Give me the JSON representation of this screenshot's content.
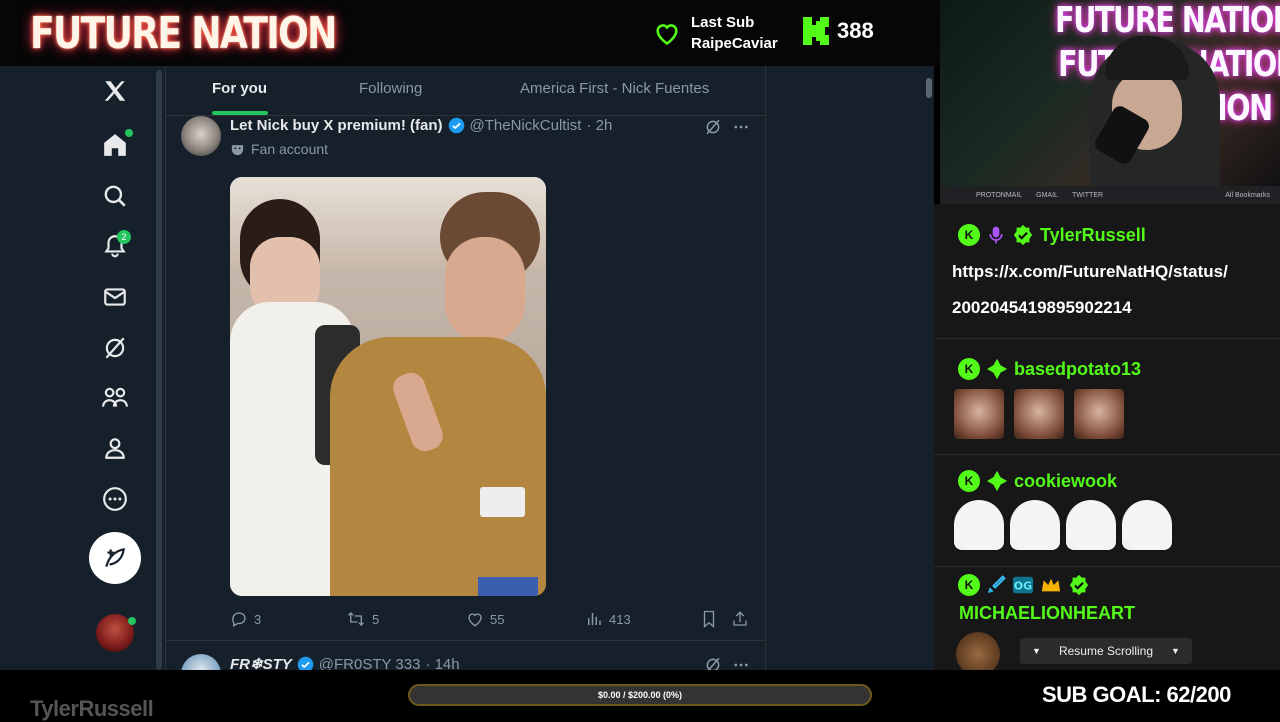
{
  "overlay": {
    "brand": "FUTURE NATION",
    "last_sub_label": "Last Sub",
    "last_sub_name": "RaipeCaviar",
    "follower_count": "388",
    "webcam_sign": [
      "FUTURE NATION",
      "FUTURE NATION",
      "NATION"
    ],
    "sub_goal": "SUB GOAL: 62/200",
    "tip_progress": "$0.00 / $200.00 (0%)",
    "footer_name": "TylerRussell",
    "colors": {
      "kick_green": "#53fc18",
      "twitter_bg": "#15202b"
    }
  },
  "browser": {
    "bookmarks": [
      "PROTONMAIL",
      "GMAIL",
      "TWITTER",
      "All Bookmarks"
    ]
  },
  "twitter": {
    "nav": {
      "notifications_count": "2",
      "items": [
        "x-logo-icon",
        "home-icon",
        "search-icon",
        "bell-icon",
        "mail-icon",
        "grok-icon",
        "communities-icon",
        "profile-icon",
        "more-icon"
      ]
    },
    "tabs": [
      "For you",
      "Following",
      "America First - Nick Fuentes"
    ],
    "tweets": [
      {
        "name": "Let Nick buy X premium! (fan)",
        "handle": "@TheNickCultist",
        "time": "· 2h",
        "label": "Fan account",
        "replies": "3",
        "reposts": "5",
        "likes": "55",
        "views": "413"
      },
      {
        "name": "FR❄STY",
        "handle": "@FR0STY 333",
        "time": "· 14h"
      }
    ]
  },
  "chat": {
    "messages": [
      {
        "user": "TylerRussell",
        "text_lines": [
          "https://x.com/FutureNatHQ/status/",
          "2002045419895902214"
        ]
      },
      {
        "user": "basedpotato13",
        "emote_count": 3
      },
      {
        "user": "cookiewook",
        "emote_count": 4
      },
      {
        "user": "MICHAELIONHEART"
      }
    ],
    "resume_label": "Resume Scrolling"
  }
}
